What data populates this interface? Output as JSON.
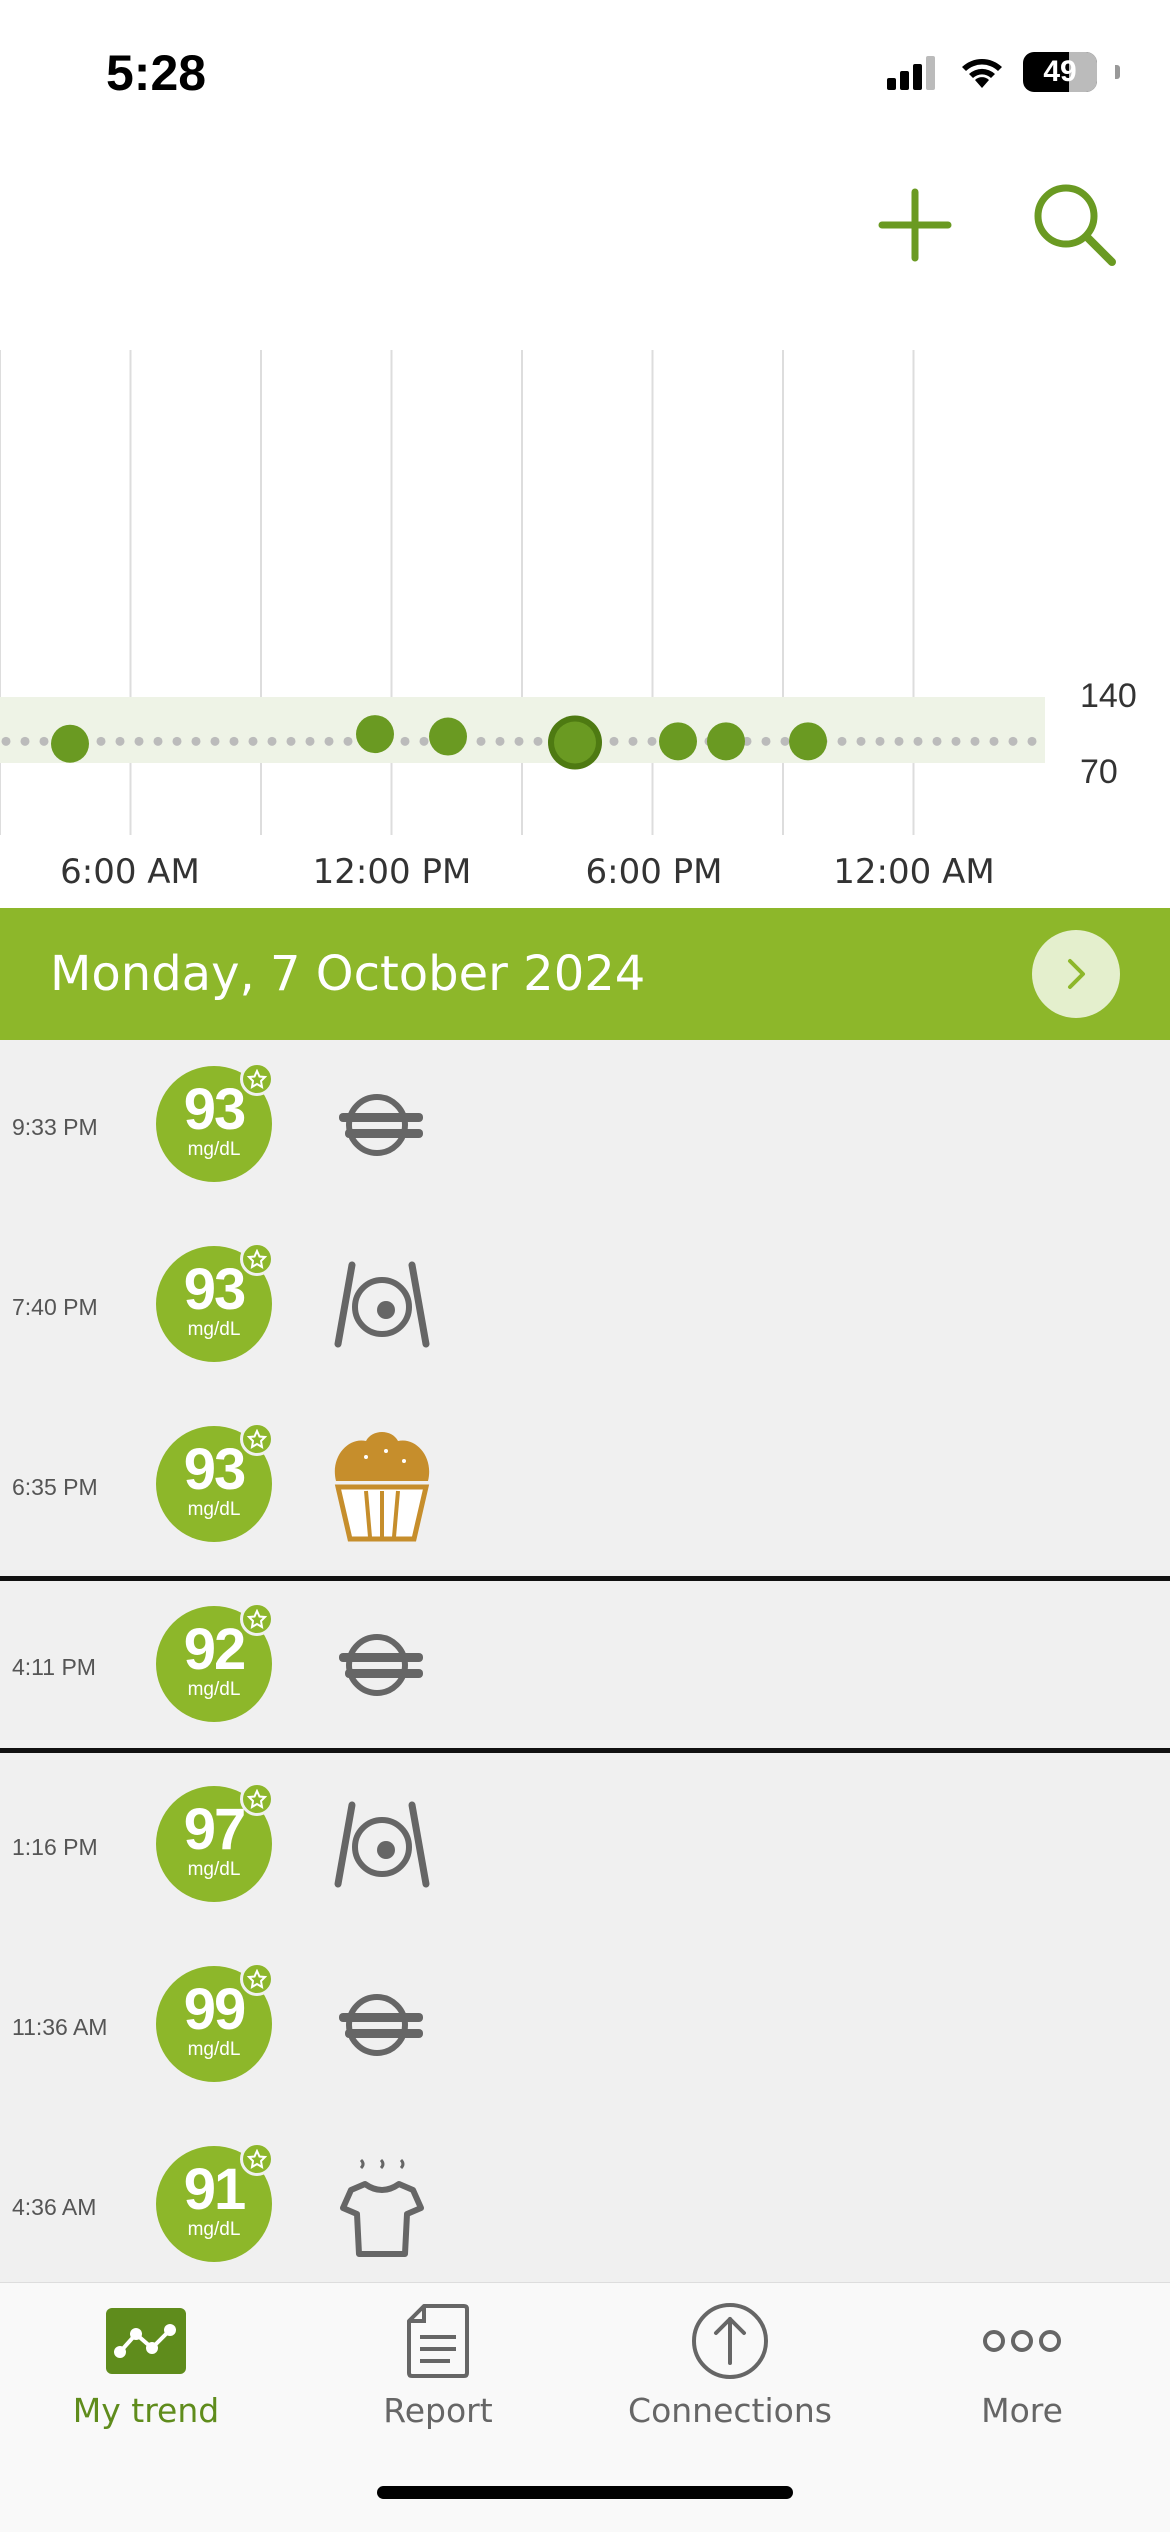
{
  "status_bar": {
    "time": "5:28",
    "battery": "49"
  },
  "top_actions": {
    "add_icon": "plus-icon",
    "search_icon": "search-icon"
  },
  "chart_data": {
    "type": "scatter",
    "x_tick_labels": [
      "6:00 AM",
      "12:00 PM",
      "6:00 PM",
      "12:00 AM"
    ],
    "y_tick_labels": [
      "140",
      "70"
    ],
    "target_range": [
      70,
      140
    ],
    "units": "mg/dL",
    "points": [
      {
        "time": "4:36 AM",
        "value": 91
      },
      {
        "time": "11:36 AM",
        "value": 99
      },
      {
        "time": "1:16 PM",
        "value": 97
      },
      {
        "time": "4:11 PM",
        "value": 92
      },
      {
        "time": "6:35 PM",
        "value": 93
      },
      {
        "time": "7:40 PM",
        "value": 93
      },
      {
        "time": "9:33 PM",
        "value": 93
      }
    ],
    "grid": true,
    "colors": {
      "point": "#6a9a22",
      "range": "#eef3e6",
      "dots": "#bbbbbb",
      "grid": "#dddddd"
    }
  },
  "date_banner": {
    "text": "Monday, 7 October 2024"
  },
  "entries": [
    {
      "time": "9:33 PM",
      "value": "93",
      "unit": "mg/dL",
      "icon": "plate-cutlery-icon"
    },
    {
      "time": "7:40 PM",
      "value": "93",
      "unit": "mg/dL",
      "icon": "meal-plate-icon"
    },
    {
      "time": "6:35 PM",
      "value": "93",
      "unit": "mg/dL",
      "icon": "muffin-icon"
    },
    {
      "time": "4:11 PM",
      "value": "92",
      "unit": "mg/dL",
      "icon": "plate-cutlery-icon"
    },
    {
      "time": "1:16 PM",
      "value": "97",
      "unit": "mg/dL",
      "icon": "meal-plate-icon"
    },
    {
      "time": "11:36 AM",
      "value": "99",
      "unit": "mg/dL",
      "icon": "plate-cutlery-icon"
    },
    {
      "time": "4:36 AM",
      "value": "91",
      "unit": "mg/dL",
      "icon": "shirt-icon"
    }
  ],
  "tabs": [
    {
      "label": "My trend",
      "icon": "trend-icon",
      "active": true
    },
    {
      "label": "Report",
      "icon": "report-icon",
      "active": false
    },
    {
      "label": "Connections",
      "icon": "connections-icon",
      "active": false
    },
    {
      "label": "More",
      "icon": "more-icon",
      "active": false
    }
  ],
  "colors": {
    "brand": "#8db72a",
    "brand_dark": "#5f8c1c",
    "list_bg": "#f0f0f0"
  }
}
